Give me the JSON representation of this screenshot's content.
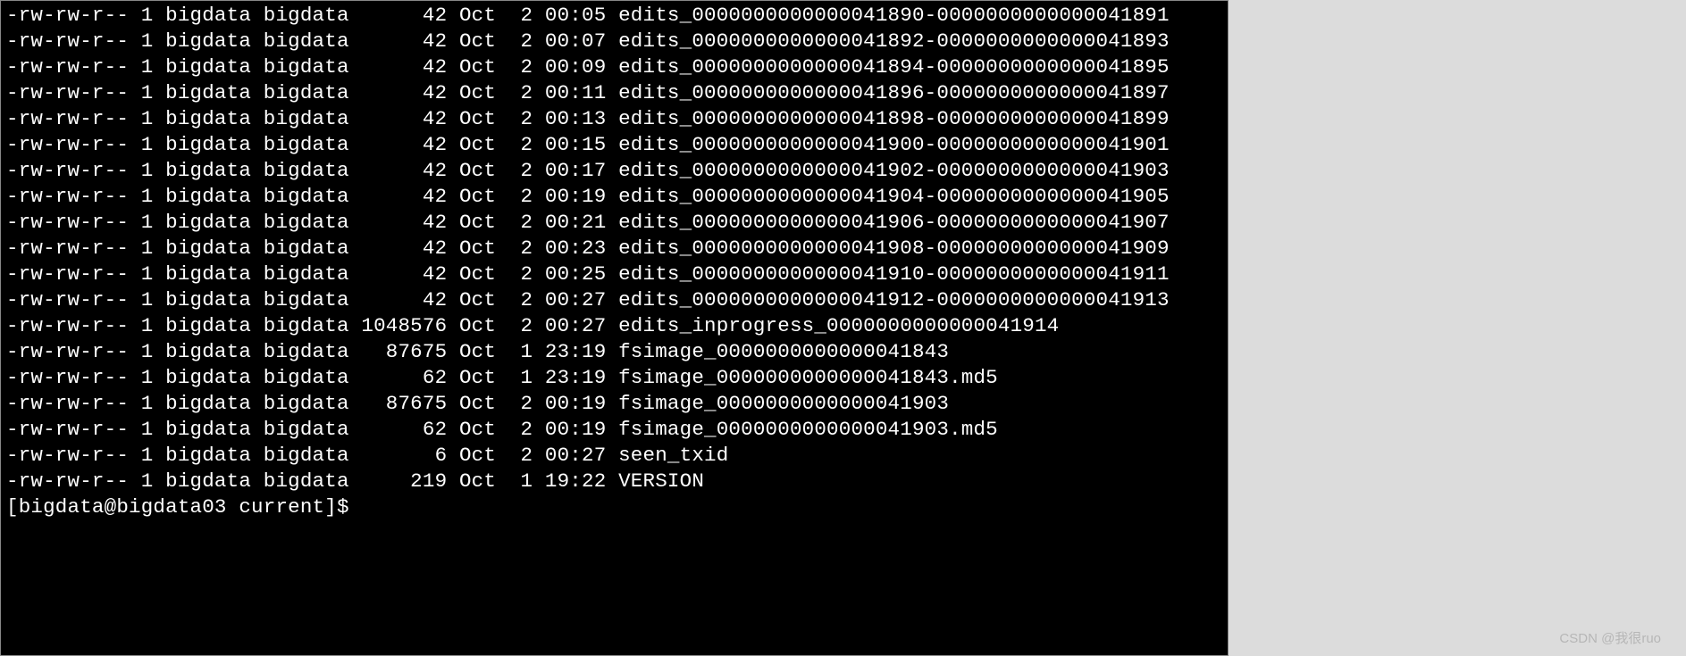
{
  "listing": [
    {
      "perms": "-rw-rw-r--",
      "links": "1",
      "owner": "bigdata",
      "group": "bigdata",
      "size": "42",
      "month": "Oct",
      "day": "2",
      "time": "00:05",
      "name": "edits_0000000000000041890-0000000000000041891"
    },
    {
      "perms": "-rw-rw-r--",
      "links": "1",
      "owner": "bigdata",
      "group": "bigdata",
      "size": "42",
      "month": "Oct",
      "day": "2",
      "time": "00:07",
      "name": "edits_0000000000000041892-0000000000000041893"
    },
    {
      "perms": "-rw-rw-r--",
      "links": "1",
      "owner": "bigdata",
      "group": "bigdata",
      "size": "42",
      "month": "Oct",
      "day": "2",
      "time": "00:09",
      "name": "edits_0000000000000041894-0000000000000041895"
    },
    {
      "perms": "-rw-rw-r--",
      "links": "1",
      "owner": "bigdata",
      "group": "bigdata",
      "size": "42",
      "month": "Oct",
      "day": "2",
      "time": "00:11",
      "name": "edits_0000000000000041896-0000000000000041897"
    },
    {
      "perms": "-rw-rw-r--",
      "links": "1",
      "owner": "bigdata",
      "group": "bigdata",
      "size": "42",
      "month": "Oct",
      "day": "2",
      "time": "00:13",
      "name": "edits_0000000000000041898-0000000000000041899"
    },
    {
      "perms": "-rw-rw-r--",
      "links": "1",
      "owner": "bigdata",
      "group": "bigdata",
      "size": "42",
      "month": "Oct",
      "day": "2",
      "time": "00:15",
      "name": "edits_0000000000000041900-0000000000000041901"
    },
    {
      "perms": "-rw-rw-r--",
      "links": "1",
      "owner": "bigdata",
      "group": "bigdata",
      "size": "42",
      "month": "Oct",
      "day": "2",
      "time": "00:17",
      "name": "edits_0000000000000041902-0000000000000041903"
    },
    {
      "perms": "-rw-rw-r--",
      "links": "1",
      "owner": "bigdata",
      "group": "bigdata",
      "size": "42",
      "month": "Oct",
      "day": "2",
      "time": "00:19",
      "name": "edits_0000000000000041904-0000000000000041905"
    },
    {
      "perms": "-rw-rw-r--",
      "links": "1",
      "owner": "bigdata",
      "group": "bigdata",
      "size": "42",
      "month": "Oct",
      "day": "2",
      "time": "00:21",
      "name": "edits_0000000000000041906-0000000000000041907"
    },
    {
      "perms": "-rw-rw-r--",
      "links": "1",
      "owner": "bigdata",
      "group": "bigdata",
      "size": "42",
      "month": "Oct",
      "day": "2",
      "time": "00:23",
      "name": "edits_0000000000000041908-0000000000000041909"
    },
    {
      "perms": "-rw-rw-r--",
      "links": "1",
      "owner": "bigdata",
      "group": "bigdata",
      "size": "42",
      "month": "Oct",
      "day": "2",
      "time": "00:25",
      "name": "edits_0000000000000041910-0000000000000041911"
    },
    {
      "perms": "-rw-rw-r--",
      "links": "1",
      "owner": "bigdata",
      "group": "bigdata",
      "size": "42",
      "month": "Oct",
      "day": "2",
      "time": "00:27",
      "name": "edits_0000000000000041912-0000000000000041913"
    },
    {
      "perms": "-rw-rw-r--",
      "links": "1",
      "owner": "bigdata",
      "group": "bigdata",
      "size": "1048576",
      "month": "Oct",
      "day": "2",
      "time": "00:27",
      "name": "edits_inprogress_0000000000000041914"
    },
    {
      "perms": "-rw-rw-r--",
      "links": "1",
      "owner": "bigdata",
      "group": "bigdata",
      "size": "87675",
      "month": "Oct",
      "day": "1",
      "time": "23:19",
      "name": "fsimage_0000000000000041843"
    },
    {
      "perms": "-rw-rw-r--",
      "links": "1",
      "owner": "bigdata",
      "group": "bigdata",
      "size": "62",
      "month": "Oct",
      "day": "1",
      "time": "23:19",
      "name": "fsimage_0000000000000041843.md5"
    },
    {
      "perms": "-rw-rw-r--",
      "links": "1",
      "owner": "bigdata",
      "group": "bigdata",
      "size": "87675",
      "month": "Oct",
      "day": "2",
      "time": "00:19",
      "name": "fsimage_0000000000000041903"
    },
    {
      "perms": "-rw-rw-r--",
      "links": "1",
      "owner": "bigdata",
      "group": "bigdata",
      "size": "62",
      "month": "Oct",
      "day": "2",
      "time": "00:19",
      "name": "fsimage_0000000000000041903.md5"
    },
    {
      "perms": "-rw-rw-r--",
      "links": "1",
      "owner": "bigdata",
      "group": "bigdata",
      "size": "6",
      "month": "Oct",
      "day": "2",
      "time": "00:27",
      "name": "seen_txid"
    },
    {
      "perms": "-rw-rw-r--",
      "links": "1",
      "owner": "bigdata",
      "group": "bigdata",
      "size": "219",
      "month": "Oct",
      "day": "1",
      "time": "19:22",
      "name": "VERSION"
    }
  ],
  "prompt": "[bigdata@bigdata03 current]$ ",
  "watermark": "CSDN @我很ruo"
}
